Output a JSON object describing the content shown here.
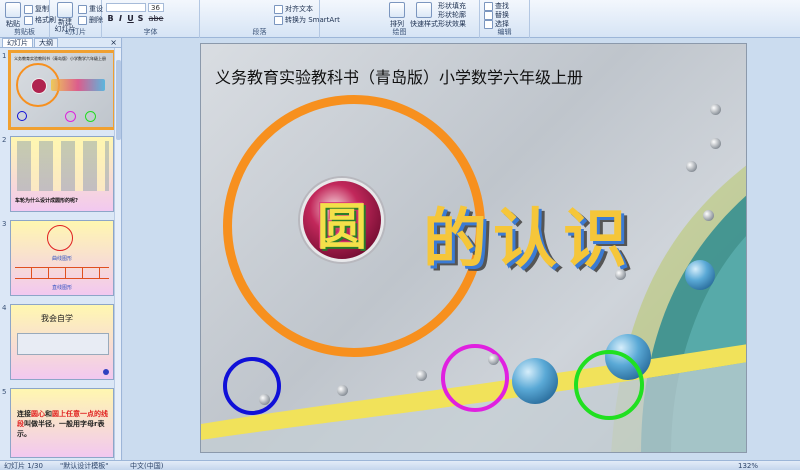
{
  "ribbon": {
    "groups": [
      "剪贴板",
      "幻灯片",
      "字体",
      "段落",
      "绘图",
      "编辑"
    ],
    "paste_label": "粘贴",
    "copy_label": "复制",
    "format_painter_label": "格式刷",
    "new_slide_label": "新建\n幻灯片",
    "reset_label": "重设",
    "delete_label": "删除",
    "font_size": "36",
    "align_text_label": "对齐文本",
    "smartart_label": "转换为 SmartArt",
    "arrange_label": "排列",
    "quick_styles_label": "快速样式",
    "shape_fill_label": "形状填充",
    "shape_outline_label": "形状轮廓",
    "shape_effects_label": "形状效果",
    "find_label": "查找",
    "replace_label": "替换",
    "select_label": "选择",
    "font_bold": "B",
    "font_italic": "I",
    "font_underline": "U",
    "font_shadow": "S",
    "font_strike": "abe"
  },
  "panel": {
    "tabs": [
      "幻灯片",
      "大纲"
    ],
    "close_label": "×",
    "thumbs": [
      {
        "num": "1",
        "title": "义务教育实验教科书（青岛版）小学数学六年级上册"
      },
      {
        "num": "2",
        "caption": "车轮为什么设计成圆形的呢?"
      },
      {
        "num": "3",
        "top": "曲线图形",
        "bottom": "直线图形"
      },
      {
        "num": "4",
        "title": "我会自学"
      },
      {
        "num": "5",
        "text1": "连接",
        "hl1": "圆心",
        "text2": "和",
        "hl2": "圆上任意一点的线段",
        "text3": "叫做半径，一般用字母r表示。"
      }
    ]
  },
  "slide": {
    "title": "义务教育实验教科书（青岛版）小学数学六年级上册",
    "badge_char": "圆",
    "title_chars": "的认识",
    "colors": {
      "orange_ring": "#f7901e",
      "blue_ring": "#1010d8",
      "magenta_ring": "#e020e0",
      "green_ring": "#20e020"
    }
  },
  "status": {
    "slide_info": "幻灯片 1/30",
    "theme": "\"默认设计模板\"",
    "language": "中文(中国)",
    "zoom": "132%"
  }
}
